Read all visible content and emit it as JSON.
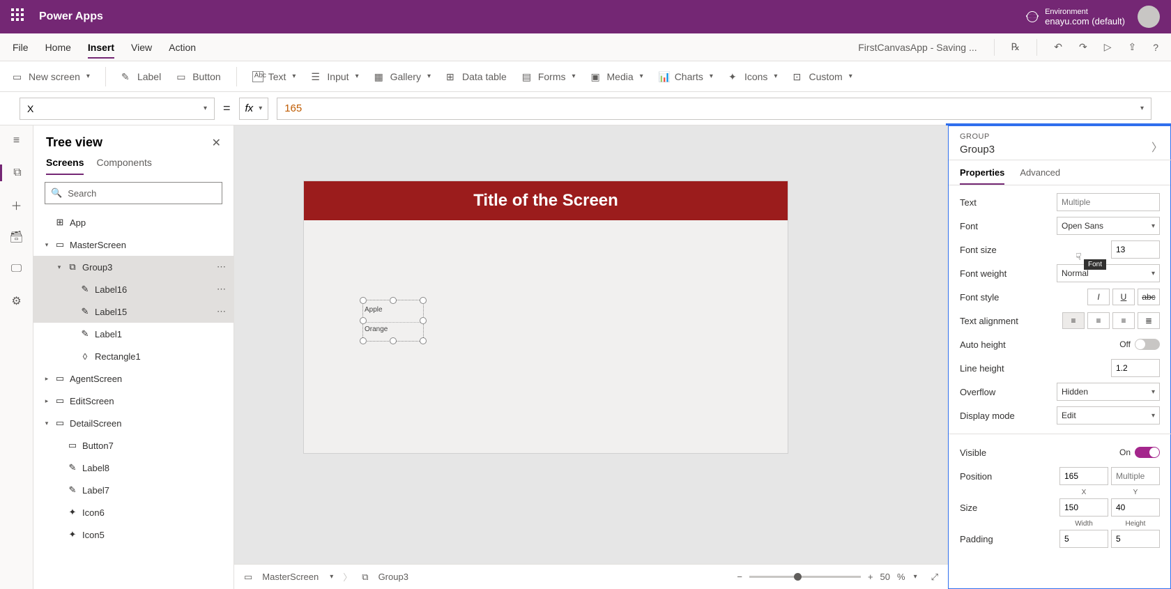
{
  "header": {
    "app_title": "Power Apps",
    "env_label": "Environment",
    "env_value": "enayu.com (default)"
  },
  "menu": {
    "items": [
      "File",
      "Home",
      "Insert",
      "View",
      "Action"
    ],
    "active": "Insert",
    "doc_title": "FirstCanvasApp - Saving ..."
  },
  "ribbon": {
    "new_screen": "New screen",
    "label": "Label",
    "button": "Button",
    "text": "Text",
    "input": "Input",
    "gallery": "Gallery",
    "datatable": "Data table",
    "forms": "Forms",
    "media": "Media",
    "charts": "Charts",
    "icons": "Icons",
    "custom": "Custom"
  },
  "formula": {
    "property": "X",
    "value": "165"
  },
  "treeview": {
    "title": "Tree view",
    "tabs": [
      "Screens",
      "Components"
    ],
    "search_placeholder": "Search",
    "nodes": [
      {
        "label": "App",
        "icon": "app",
        "indent": 0,
        "caret": ""
      },
      {
        "label": "MasterScreen",
        "icon": "screen",
        "indent": 0,
        "caret": "▾"
      },
      {
        "label": "Group3",
        "icon": "group",
        "indent": 1,
        "caret": "▾",
        "sel": true,
        "dots": true
      },
      {
        "label": "Label16",
        "icon": "label",
        "indent": 2,
        "caret": "",
        "sel": true,
        "dots": true
      },
      {
        "label": "Label15",
        "icon": "label",
        "indent": 2,
        "caret": "",
        "sel": true,
        "dots": true
      },
      {
        "label": "Label1",
        "icon": "label",
        "indent": 2,
        "caret": ""
      },
      {
        "label": "Rectangle1",
        "icon": "rect",
        "indent": 2,
        "caret": ""
      },
      {
        "label": "AgentScreen",
        "icon": "screen",
        "indent": 0,
        "caret": "▸"
      },
      {
        "label": "EditScreen",
        "icon": "screen",
        "indent": 0,
        "caret": "▸"
      },
      {
        "label": "DetailScreen",
        "icon": "screen",
        "indent": 0,
        "caret": "▾"
      },
      {
        "label": "Button7",
        "icon": "button",
        "indent": 1,
        "caret": ""
      },
      {
        "label": "Label8",
        "icon": "label",
        "indent": 1,
        "caret": ""
      },
      {
        "label": "Label7",
        "icon": "label",
        "indent": 1,
        "caret": ""
      },
      {
        "label": "Icon6",
        "icon": "icon",
        "indent": 1,
        "caret": ""
      },
      {
        "label": "Icon5",
        "icon": "icon",
        "indent": 1,
        "caret": ""
      }
    ]
  },
  "canvas": {
    "screen_title": "Title of the Screen",
    "group_label1": "Apple",
    "group_label2": "Orange"
  },
  "breadcrumb": {
    "screen": "MasterScreen",
    "selection": "Group3",
    "zoom": "50",
    "zoom_suffix": "%"
  },
  "props": {
    "type": "GROUP",
    "name": "Group3",
    "tabs": [
      "Properties",
      "Advanced"
    ],
    "tooltip": "Font",
    "rows": {
      "text_label": "Text",
      "text_placeholder": "Multiple",
      "font_label": "Font",
      "font_value": "Open Sans",
      "fontsize_label": "Font size",
      "fontsize_value": "13",
      "fontweight_label": "Font weight",
      "fontweight_value": "Normal",
      "fontstyle_label": "Font style",
      "textalign_label": "Text alignment",
      "autoheight_label": "Auto height",
      "autoheight_state": "Off",
      "lineheight_label": "Line height",
      "lineheight_value": "1.2",
      "overflow_label": "Overflow",
      "overflow_value": "Hidden",
      "displaymode_label": "Display mode",
      "displaymode_value": "Edit",
      "visible_label": "Visible",
      "visible_state": "On",
      "position_label": "Position",
      "position_x": "165",
      "position_y_placeholder": "Multiple",
      "position_xlbl": "X",
      "position_ylbl": "Y",
      "size_label": "Size",
      "size_w": "150",
      "size_h": "40",
      "size_wlbl": "Width",
      "size_hlbl": "Height",
      "padding_label": "Padding",
      "padding_1": "5",
      "padding_2": "5"
    }
  }
}
